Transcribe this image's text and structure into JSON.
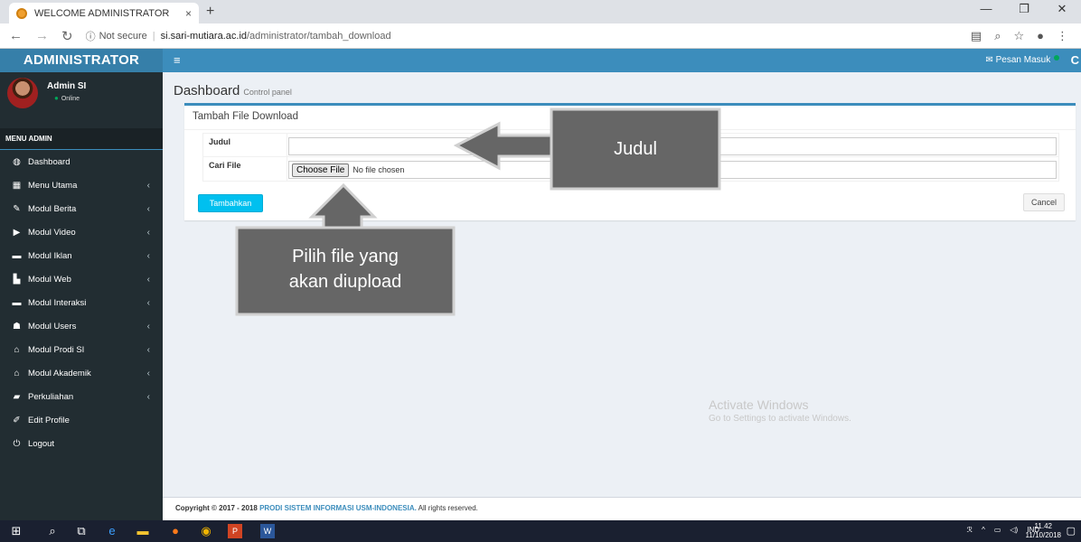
{
  "browser": {
    "tab_title": "WELCOME ADMINISTRATOR",
    "tab_close": "×",
    "new_tab": "+",
    "security_label": "Not secure",
    "url_host": "si.sari-mutiara.ac.id",
    "url_path": "/administrator/tambah_download"
  },
  "header": {
    "logo": "ADMINISTRATOR",
    "inbox_label": "Pesan Masuk"
  },
  "user": {
    "name": "Admin SI",
    "status": "Online"
  },
  "sidebar": {
    "header": "MENU ADMIN",
    "items": [
      {
        "label": "Dashboard",
        "icon": "dashboard-icon",
        "has_caret": false
      },
      {
        "label": "Menu Utama",
        "icon": "table-icon",
        "has_caret": true
      },
      {
        "label": "Modul Berita",
        "icon": "pencil-icon",
        "has_caret": true
      },
      {
        "label": "Modul Video",
        "icon": "play-icon",
        "has_caret": true
      },
      {
        "label": "Modul Iklan",
        "icon": "laptop-icon",
        "has_caret": true
      },
      {
        "label": "Modul Web",
        "icon": "image-icon",
        "has_caret": true
      },
      {
        "label": "Modul Interaksi",
        "icon": "laptop-icon",
        "has_caret": true
      },
      {
        "label": "Modul Users",
        "icon": "users-icon",
        "has_caret": true
      },
      {
        "label": "Modul Prodi SI",
        "icon": "institution-icon",
        "has_caret": true
      },
      {
        "label": "Modul Akademik",
        "icon": "institution-icon",
        "has_caret": true
      },
      {
        "label": "Perkuliahan",
        "icon": "book-icon",
        "has_caret": true
      },
      {
        "label": "Edit Profile",
        "icon": "edit-icon",
        "has_caret": false
      },
      {
        "label": "Logout",
        "icon": "power-icon",
        "has_caret": false
      }
    ]
  },
  "content": {
    "title": "Dashboard",
    "subtitle": "Control panel",
    "box_title": "Tambah File Download",
    "field_judul_label": "Judul",
    "field_judul_value": "",
    "field_file_label": "Cari File",
    "file_button": "Choose File",
    "file_status": "No file chosen",
    "submit_label": "Tambahkan",
    "cancel_label": "Cancel"
  },
  "annotations": {
    "judul_callout": "Judul",
    "file_callout_line1": "Pilih file yang",
    "file_callout_line2": "akan diupload"
  },
  "watermark": {
    "title": "Activate Windows",
    "subtitle": "Go to Settings to activate Windows."
  },
  "footer": {
    "prefix": "Copyright © 2017 - 2018",
    "brand": "PRODI SISTEM INFORMASI USM-INDONESIA.",
    "suffix": "All rights reserved."
  },
  "taskbar": {
    "language": "IND",
    "time": "11.42",
    "date": "11/10/2018"
  },
  "colors": {
    "header_blue": "#3c8dbc",
    "sidebar_dark": "#222d32",
    "submit_cyan": "#00c0ef",
    "callout_gray": "#666666"
  }
}
